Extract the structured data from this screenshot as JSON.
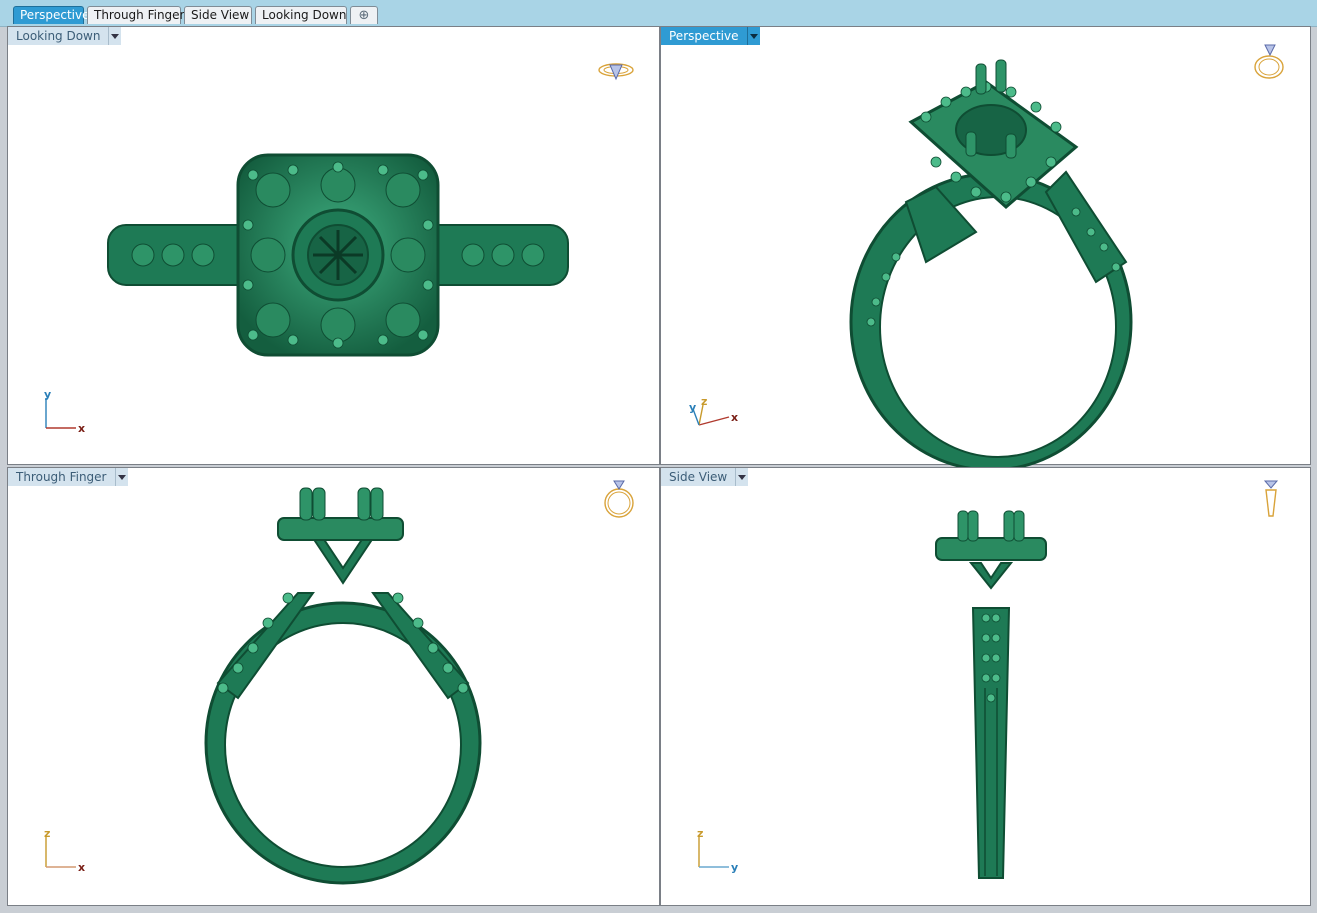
{
  "tabs": [
    {
      "label": "Perspective",
      "active": true
    },
    {
      "label": "Through Finger",
      "active": false
    },
    {
      "label": "Side View",
      "active": false
    },
    {
      "label": "Looking Down",
      "active": false
    }
  ],
  "add_tab_icon": "plus-icon",
  "viewports": {
    "top_left": {
      "label": "Looking Down",
      "axes": [
        "y",
        "x"
      ]
    },
    "top_right": {
      "label": "Perspective",
      "axes": [
        "y",
        "z",
        "x"
      ]
    },
    "bottom_left": {
      "label": "Through Finger",
      "axes": [
        "z",
        "x"
      ]
    },
    "bottom_right": {
      "label": "Side View",
      "axes": [
        "z",
        "y"
      ]
    }
  },
  "colors": {
    "model": "#1e7a55",
    "model_dark": "#0f4d33",
    "model_light": "#3fae80",
    "active_accent": "#2f9bd3",
    "axis_x": "#b03a2e",
    "axis_y": "#2a7fb8",
    "axis_z": "#c89a2c"
  }
}
